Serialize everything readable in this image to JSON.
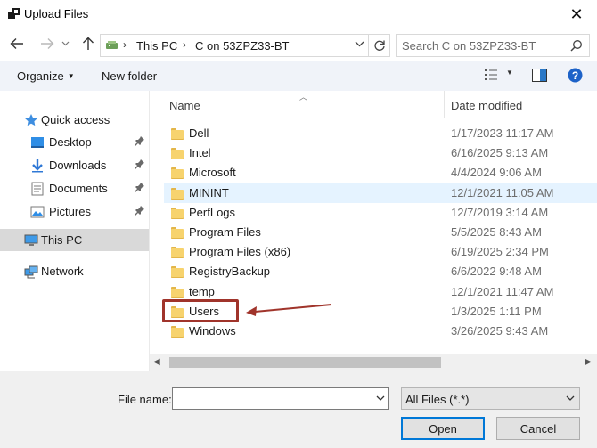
{
  "window": {
    "title": "Upload Files",
    "close_symbol": "✕"
  },
  "nav": {
    "address": {
      "crumbs": [
        "This PC",
        "C on 53ZPZ33-BT"
      ]
    },
    "search": {
      "placeholder": "Search C on 53ZPZ33-BT"
    }
  },
  "toolbar": {
    "organize": "Organize",
    "new_folder": "New folder"
  },
  "sidebar": {
    "items": [
      {
        "label": "Quick access",
        "icon": "star-icon"
      },
      {
        "label": "Desktop",
        "icon": "desktop-icon",
        "pinned": true
      },
      {
        "label": "Downloads",
        "icon": "download-icon",
        "pinned": true
      },
      {
        "label": "Documents",
        "icon": "documents-icon",
        "pinned": true
      },
      {
        "label": "Pictures",
        "icon": "pictures-icon",
        "pinned": true
      },
      {
        "label": "This PC",
        "icon": "computer-icon",
        "selected": true
      },
      {
        "label": "Network",
        "icon": "network-icon"
      }
    ]
  },
  "list": {
    "columns": {
      "name": "Name",
      "date": "Date modified"
    },
    "rows": [
      {
        "name": "Dell",
        "date": "1/17/2023 11:17 AM"
      },
      {
        "name": "Intel",
        "date": "6/16/2025 9:13 AM"
      },
      {
        "name": "Microsoft",
        "date": "4/4/2024 9:06 AM"
      },
      {
        "name": "MININT",
        "date": "12/1/2021 11:05 AM"
      },
      {
        "name": "PerfLogs",
        "date": "12/7/2019 3:14 AM"
      },
      {
        "name": "Program Files",
        "date": "5/5/2025 8:43 AM"
      },
      {
        "name": "Program Files (x86)",
        "date": "6/19/2025 2:34 PM"
      },
      {
        "name": "RegistryBackup",
        "date": "6/6/2022 9:48 AM"
      },
      {
        "name": "temp",
        "date": "12/1/2021 11:47 AM"
      },
      {
        "name": "Users",
        "date": "1/3/2025 1:11 PM"
      },
      {
        "name": "Windows",
        "date": "3/26/2025 9:43 AM"
      }
    ],
    "hovered_row": "MININT",
    "annotated_row": "Users"
  },
  "bottom": {
    "file_name_label": "File name:",
    "file_name_value": "",
    "file_type": "All Files (*.*)",
    "open": "Open",
    "cancel": "Cancel"
  },
  "colors": {
    "accent": "#0078d7",
    "annotation": "#a0342b",
    "folder": "#f7d36e"
  }
}
